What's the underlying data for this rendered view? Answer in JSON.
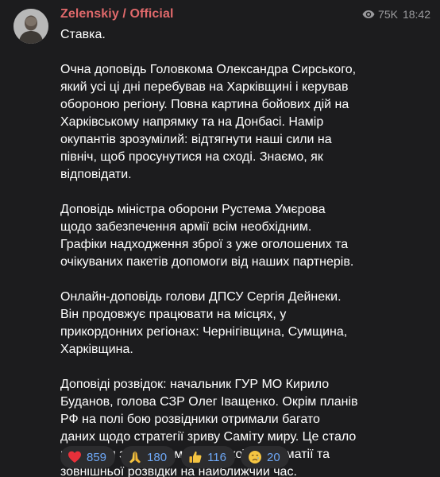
{
  "channel": {
    "name": "Zelenskiy / Official"
  },
  "meta": {
    "views": "75K",
    "time": "18:42",
    "views_icon": "eye-icon"
  },
  "post": {
    "paragraphs": [
      "Ставка.",
      "Очна доповідь Головкома Олександра Сирського,\nякий усі ці дні перебував на Харківщині і керував\nобороною регіону. Повна картина бойових дій на\nХарківському напрямку та на Донбасі. Намір\nокупантів зрозумілий: відтягнути наші сили на\nпівніч, щоб просунутися на сході. Знаємо, як\nвідповідати.",
      "Доповідь міністра оборони Рустема Умєрова\nщодо забезпечення армії всім необхідним.\nГрафіки надходження зброї з уже оголошених та\nочікуваних пакетів допомоги від наших партнерів.",
      "Онлайн-доповідь голови ДПСУ Сергія Дейнеки.\nВін продовжує працювати на місцях, у\nприкордонних регіонах: Чернігівщина, Сумщина,\nХарківщина.",
      "Доповіді розвідок: начальник ГУР МО Кирило\nБуданов, голова СЗР Олег Іващенко. Окрім планів\nРФ на полі бою розвідники отримали багато\nданих щодо стратегії зриву Саміту миру. Це стало\nголовним завданням російської дипломатії та\nзовнішньої розвідки на найближчий час."
    ]
  },
  "reactions": [
    {
      "icon": "heart-icon",
      "count": "859"
    },
    {
      "icon": "praying-hands-icon",
      "count": "180"
    },
    {
      "icon": "thumbs-up-icon",
      "count": "116"
    },
    {
      "icon": "crying-face-icon",
      "count": "20"
    }
  ],
  "colors": {
    "background": "#1c1c1e",
    "channel_name": "#e0696b",
    "reaction_count": "#6ea8f7",
    "meta_text": "#9a9a9d"
  }
}
